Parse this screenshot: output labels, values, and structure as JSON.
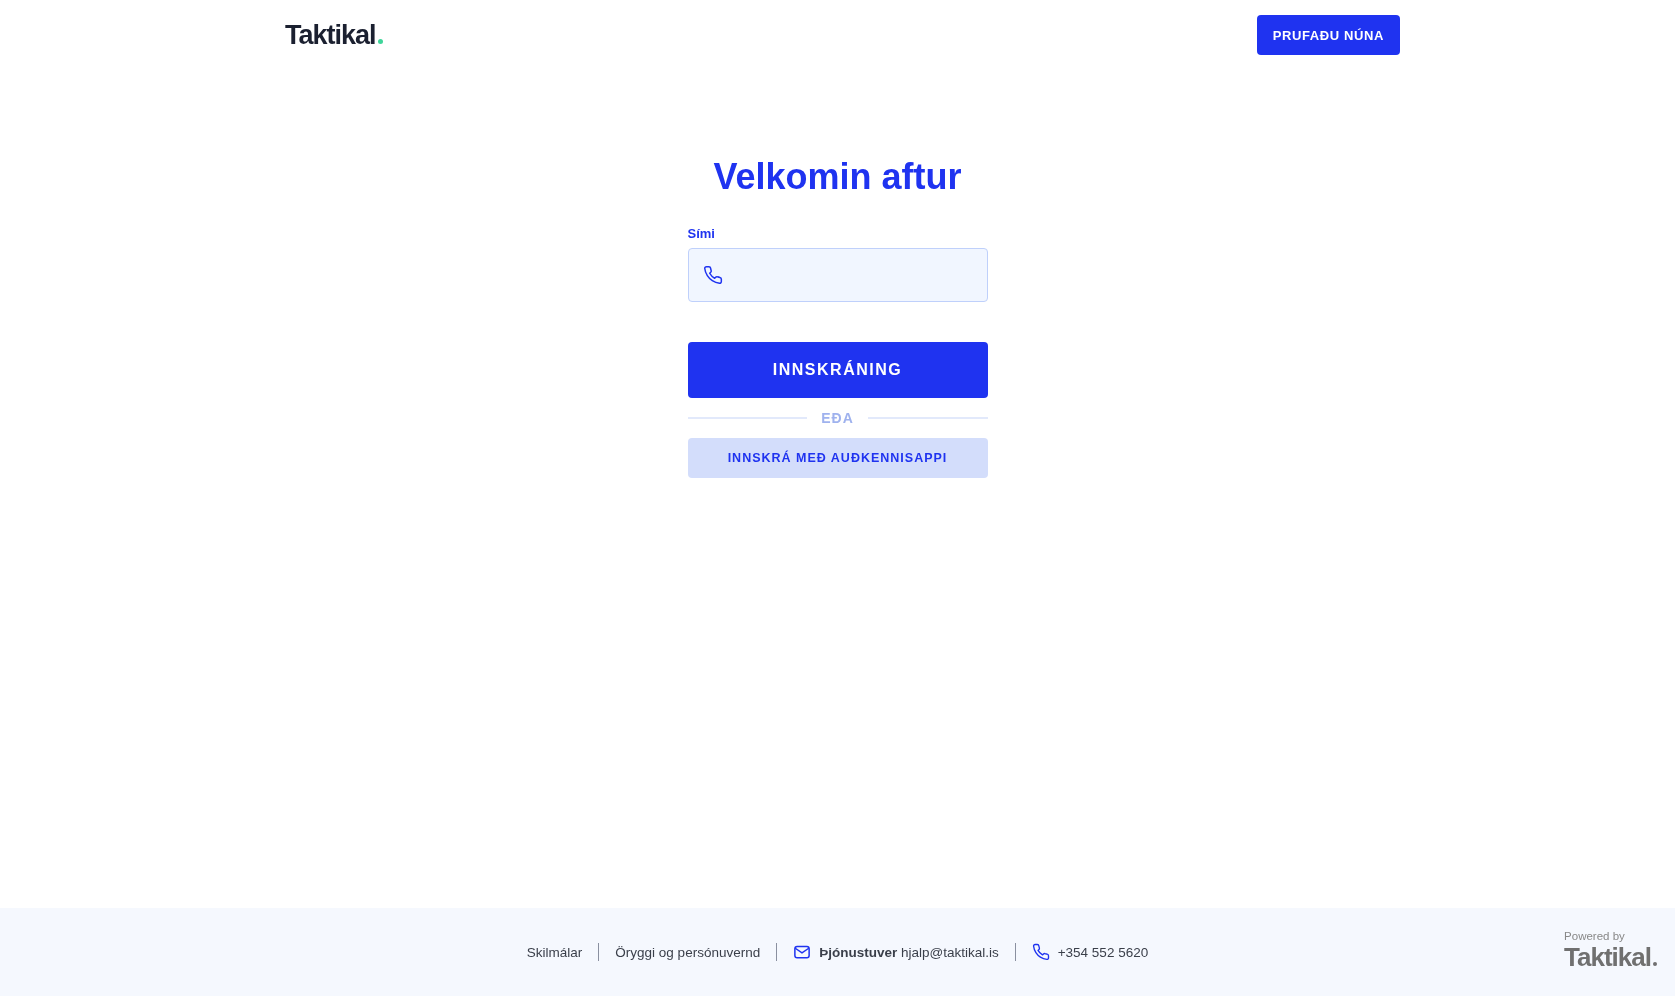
{
  "header": {
    "logo": "Taktikal",
    "cta_button": "PRUFAÐU NÚNA"
  },
  "login": {
    "title": "Velkomin aftur",
    "phone_field": {
      "label": "Sími"
    },
    "login_button": "INNSKRÁNING",
    "divider": "EÐA",
    "alt_button": "INNSKRÁ MEÐ AUÐKENNISAPPI"
  },
  "footer": {
    "links": [
      {
        "kind": "link",
        "text": "Skilmálar"
      },
      {
        "kind": "link",
        "text": "Öryggi og persónuvernd"
      },
      {
        "kind": "email",
        "text": "**Þjónustuver** hjalp@taktikal.is"
      },
      {
        "kind": "phone",
        "text": "+354 552 5620"
      }
    ],
    "powered_by": "Powered by",
    "powered_logo": "Taktikal"
  }
}
